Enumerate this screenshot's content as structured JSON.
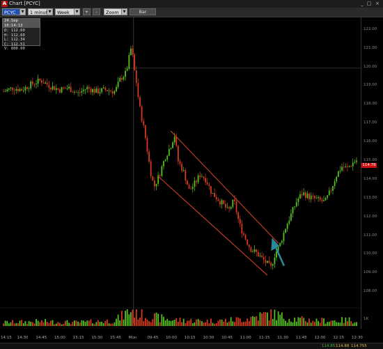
{
  "window": {
    "title": "Chart [PCYC]",
    "logo": "A",
    "minimize": "_",
    "maximize": "□",
    "close": "×"
  },
  "toolbar": {
    "symbol": "PCYC",
    "interval": "1 minute",
    "range": "Week",
    "plus": "+",
    "minus": "-",
    "zoom": "Zoom",
    "bar": "Bar"
  },
  "infobox": {
    "header": "24.Sep 10:14:13",
    "open": "O: 112.60",
    "high": "H: 112.60",
    "low": "L: 112.34",
    "close": "C: 112.51",
    "volume": "V: 800.00"
  },
  "price_axis": [
    "122.00",
    "121.00",
    "120.00",
    "119.00",
    "118.00",
    "117.00",
    "116.00",
    "115.00",
    "114.00",
    "113.00",
    "112.00",
    "111.00",
    "110.00",
    "109.00",
    "108.00"
  ],
  "current_price": "114.76",
  "volume_label": "1K",
  "time_axis": [
    "14:15",
    "14:30",
    "14:45",
    "15:00",
    "15:15",
    "15:30",
    "15:45",
    "Mon",
    "09:45",
    "10:00",
    "10:15",
    "10:30",
    "10:45",
    "11:00",
    "11:15",
    "11:30",
    "11:45",
    "12:00",
    "12:15",
    "12:30"
  ],
  "status": {
    "v1": "114.85",
    "v2": "114.88",
    "v3": "114.755"
  },
  "colors": {
    "up": "#55c21b",
    "down": "#d83a1e",
    "channel": "#e0442a",
    "arrow": "#2a8a9a",
    "current": "#d01010"
  },
  "chart_data": {
    "type": "candlestick",
    "title": "",
    "xlabel": "",
    "ylabel": "",
    "ylim": [
      107.6,
      122.4
    ],
    "grid": false,
    "x": [
      "14:15",
      "14:30",
      "14:45",
      "15:00",
      "15:15",
      "15:30",
      "15:45",
      "Mon",
      "09:45",
      "10:00",
      "10:15",
      "10:30",
      "10:45",
      "11:00",
      "11:15",
      "11:30",
      "11:45",
      "12:00",
      "12:15",
      "12:30"
    ],
    "close_path": [
      [
        0,
        118.7
      ],
      [
        0.5,
        118.9
      ],
      [
        1,
        118.8
      ],
      [
        1.5,
        119.1
      ],
      [
        2,
        119.3
      ],
      [
        2.5,
        119.0
      ],
      [
        3,
        118.8
      ],
      [
        3.5,
        118.9
      ],
      [
        4,
        118.6
      ],
      [
        4.5,
        118.9
      ],
      [
        5,
        118.7
      ],
      [
        5.5,
        118.8
      ],
      [
        6,
        118.7
      ],
      [
        6.3,
        119.4
      ],
      [
        6.6,
        119.7
      ],
      [
        6.9,
        121.2
      ],
      [
        7.0,
        120.0
      ],
      [
        7.1,
        119.6
      ],
      [
        7.3,
        118.0
      ],
      [
        7.6,
        116.5
      ],
      [
        7.9,
        114.5
      ],
      [
        8.1,
        113.6
      ],
      [
        8.4,
        114.3
      ],
      [
        8.7,
        115.2
      ],
      [
        9.0,
        115.8
      ],
      [
        9.2,
        116.4
      ],
      [
        9.4,
        115.0
      ],
      [
        9.7,
        114.4
      ],
      [
        10.0,
        113.4
      ],
      [
        10.3,
        113.8
      ],
      [
        10.6,
        114.3
      ],
      [
        10.9,
        114.0
      ],
      [
        11.2,
        113.3
      ],
      [
        11.5,
        113.0
      ],
      [
        11.8,
        112.7
      ],
      [
        12.1,
        112.3
      ],
      [
        12.4,
        112.9
      ],
      [
        12.7,
        111.6
      ],
      [
        13.0,
        110.9
      ],
      [
        13.3,
        110.3
      ],
      [
        13.6,
        110.1
      ],
      [
        13.9,
        109.8
      ],
      [
        14.2,
        109.5
      ],
      [
        14.4,
        109.3
      ],
      [
        14.6,
        110.0
      ],
      [
        14.9,
        110.6
      ],
      [
        15.2,
        111.5
      ],
      [
        15.5,
        112.2
      ],
      [
        15.8,
        112.9
      ],
      [
        16.1,
        113.3
      ],
      [
        16.4,
        113.1
      ],
      [
        16.7,
        113.0
      ],
      [
        17.0,
        112.9
      ],
      [
        17.3,
        112.8
      ],
      [
        17.6,
        113.4
      ],
      [
        17.9,
        114.2
      ],
      [
        18.2,
        114.7
      ],
      [
        18.5,
        114.6
      ],
      [
        18.8,
        114.9
      ],
      [
        19.1,
        115.1
      ],
      [
        19.4,
        114.8
      ]
    ],
    "volume_path": [
      [
        0,
        0.2
      ],
      [
        2,
        0.25
      ],
      [
        4,
        0.2
      ],
      [
        6,
        0.3
      ],
      [
        6.9,
        0.9
      ],
      [
        7.5,
        0.6
      ],
      [
        8,
        0.5
      ],
      [
        9,
        0.35
      ],
      [
        10,
        0.3
      ],
      [
        11,
        0.28
      ],
      [
        12,
        0.3
      ],
      [
        13,
        0.4
      ],
      [
        14,
        0.6
      ],
      [
        14.5,
        0.7
      ],
      [
        15,
        0.5
      ],
      [
        16,
        0.35
      ],
      [
        17,
        0.3
      ],
      [
        18,
        0.3
      ],
      [
        19,
        0.35
      ]
    ],
    "prev_close": 119.95
  }
}
